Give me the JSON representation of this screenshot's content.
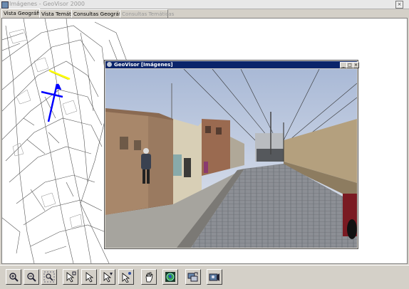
{
  "window": {
    "title": "Imágenes - GeoVisor 2000",
    "close_label": "×"
  },
  "tabs": [
    {
      "label": "Vista Geográfica",
      "state": "active"
    },
    {
      "label": "Vista Temática",
      "state": "normal"
    },
    {
      "label": "Consultas Geográficas",
      "state": "normal"
    },
    {
      "label": "Consultas Temáticas",
      "state": "disabled"
    }
  ],
  "photo_window": {
    "title": "GeoVisor [Imágenes]",
    "minimize_label": "_",
    "maximize_label": "□",
    "close_label": "×"
  },
  "toolbar": {
    "tools": [
      {
        "icon": "zoom-in-icon"
      },
      {
        "icon": "zoom-out-icon"
      },
      {
        "icon": "zoom-extent-icon"
      },
      {
        "icon": "select-pointer-icon"
      },
      {
        "icon": "select-arrow-icon"
      },
      {
        "icon": "select-edit-icon"
      },
      {
        "icon": "identify-pointer-icon"
      },
      {
        "icon": "pan-hand-icon"
      },
      {
        "icon": "globe-icon"
      },
      {
        "icon": "layers-icon"
      },
      {
        "icon": "photo-view-icon"
      }
    ]
  },
  "colors": {
    "accent_titlebar": "#0a246a",
    "map_road_highlight": "#0000ff",
    "map_selection": "#ffff00",
    "chrome": "#d4d0c8"
  }
}
